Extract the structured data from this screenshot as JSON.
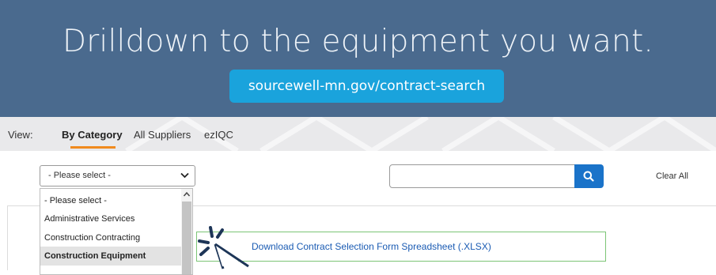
{
  "hero": {
    "headline": "Drilldown to the equipment you want.",
    "url_button": "sourcewell-mn.gov/contract-search"
  },
  "nav": {
    "view_label": "View:",
    "tabs": [
      {
        "label": "By Category",
        "active": true
      },
      {
        "label": "All Suppliers",
        "active": false
      },
      {
        "label": "ezIQC",
        "active": false
      }
    ]
  },
  "filters": {
    "category_select": {
      "value": "- Please select -",
      "options": [
        "- Please select -",
        "Administrative Services",
        "Construction Contracting",
        "Construction Equipment"
      ],
      "highlighted": "Construction Equipment"
    },
    "search": {
      "value": "",
      "placeholder": ""
    },
    "clear_all": "Clear All"
  },
  "download": {
    "link_text": "Download Contract Selection Form Spreadsheet (.XLSX)"
  },
  "colors": {
    "hero_bg": "#4a6a8e",
    "url_button_bg": "#1aa3dc",
    "active_tab_underline": "#f08a1e",
    "search_button_bg": "#1a73c9",
    "download_border": "#7cc576",
    "link": "#1a5bb3"
  },
  "icons": {
    "select_chevron": "chevron-down-icon",
    "search": "search-icon",
    "pointer": "hand-cursor-click-icon"
  }
}
